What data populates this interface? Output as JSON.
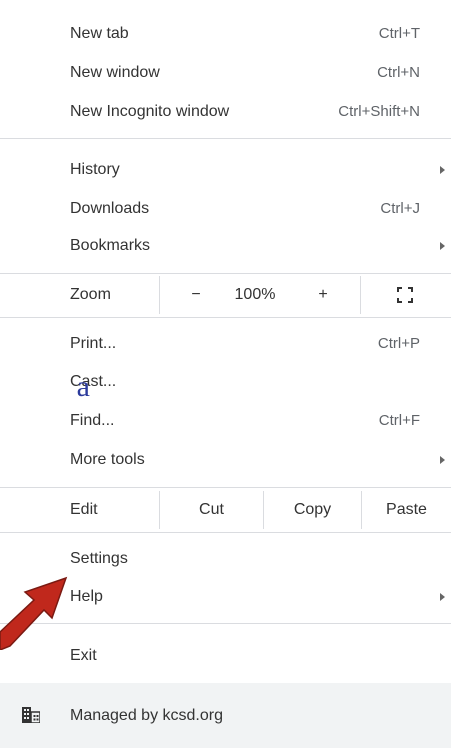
{
  "background": {
    "partial_text": "a"
  },
  "menu": {
    "new_tab": {
      "label": "New tab",
      "shortcut": "Ctrl+T"
    },
    "new_window": {
      "label": "New window",
      "shortcut": "Ctrl+N"
    },
    "new_incognito": {
      "label": "New Incognito window",
      "shortcut": "Ctrl+Shift+N"
    },
    "history": {
      "label": "History"
    },
    "downloads": {
      "label": "Downloads",
      "shortcut": "Ctrl+J"
    },
    "bookmarks": {
      "label": "Bookmarks"
    },
    "zoom": {
      "label": "Zoom",
      "minus": "−",
      "value": "100%",
      "plus": "+"
    },
    "print": {
      "label": "Print...",
      "shortcut": "Ctrl+P"
    },
    "cast": {
      "label": "Cast..."
    },
    "find": {
      "label": "Find...",
      "shortcut": "Ctrl+F"
    },
    "more_tools": {
      "label": "More tools"
    },
    "edit": {
      "label": "Edit",
      "cut": "Cut",
      "copy": "Copy",
      "paste": "Paste"
    },
    "settings": {
      "label": "Settings"
    },
    "help": {
      "label": "Help"
    },
    "exit": {
      "label": "Exit"
    },
    "managed": {
      "label": "Managed by kcsd.org"
    }
  },
  "colors": {
    "annotation_arrow": "#c0281c",
    "background_text": "#2c3b9c",
    "separator": "#dadce0",
    "managed_bg": "#f1f3f4"
  },
  "icons": {
    "fullscreen": "fullscreen-icon",
    "managed": "building-icon",
    "submenu": "chevron-right-icon",
    "annotation": "red-arrow-icon"
  }
}
